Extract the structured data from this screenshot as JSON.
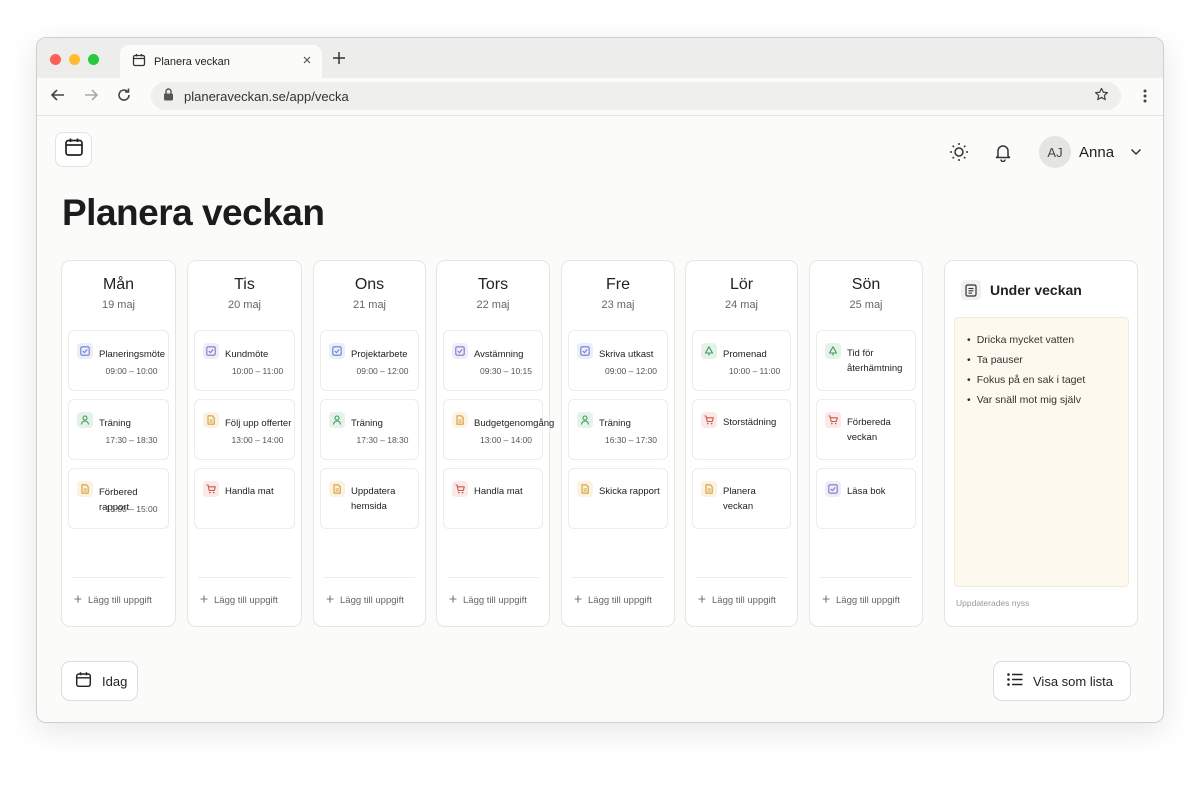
{
  "browser": {
    "tab_title": "Planera veckan",
    "url": "planeraveckan.se/app/vecka"
  },
  "header": {
    "user_initials": "AJ",
    "user_name": "Anna"
  },
  "page_title": "Planera veckan",
  "days": [
    {
      "name": "Mån",
      "date": "19 maj",
      "tasks": [
        {
          "label": "Planeringsmöte",
          "time": "09:00 – 10:00",
          "icon": "check-icon",
          "color": "#6b7fd0"
        },
        {
          "label": "Träning",
          "time": "17:30 – 18:30",
          "icon": "person-icon",
          "color": "#3f9a5a"
        },
        {
          "label": "Förbered rapport",
          "time": "13:00 – 15:00",
          "icon": "document-icon",
          "color": "#d9a030"
        }
      ]
    },
    {
      "name": "Tis",
      "date": "20 maj",
      "tasks": [
        {
          "label": "Kundmöte",
          "time": "10:00 – 11:00",
          "icon": "check-icon",
          "color": "#8a73c9"
        },
        {
          "label": "Följ upp offerter",
          "time": "13:00 – 14:00",
          "icon": "document-icon",
          "color": "#d9a030"
        },
        {
          "label": "Handla mat",
          "time": "",
          "icon": "cart-icon",
          "color": "#d0584b"
        }
      ]
    },
    {
      "name": "Ons",
      "date": "21 maj",
      "tasks": [
        {
          "label": "Projektarbete",
          "time": "09:00 – 12:00",
          "icon": "check-icon",
          "color": "#6b7fd0"
        },
        {
          "label": "Träning",
          "time": "17:30 – 18:30",
          "icon": "person-icon",
          "color": "#3f9a5a"
        },
        {
          "label": "Uppdatera hemsida",
          "time": "",
          "icon": "document-icon",
          "color": "#d9a030"
        }
      ]
    },
    {
      "name": "Tors",
      "date": "22 maj",
      "tasks": [
        {
          "label": "Avstämning",
          "time": "09:30 – 10:15",
          "icon": "check-icon",
          "color": "#8a73c9"
        },
        {
          "label": "Budgetgenomgång",
          "time": "13:00 – 14:00",
          "icon": "document-icon",
          "color": "#d9a030"
        },
        {
          "label": "Handla mat",
          "time": "",
          "icon": "cart-icon",
          "color": "#d0584b"
        }
      ]
    },
    {
      "name": "Fre",
      "date": "23 maj",
      "tasks": [
        {
          "label": "Skriva utkast",
          "time": "09:00 – 12:00",
          "icon": "check-icon",
          "color": "#6b7fd0"
        },
        {
          "label": "Träning",
          "time": "16:30 – 17:30",
          "icon": "person-icon",
          "color": "#3f9a5a"
        },
        {
          "label": "Skicka rapport",
          "time": "",
          "icon": "document-icon",
          "color": "#d9a030"
        }
      ]
    },
    {
      "name": "Lör",
      "date": "24 maj",
      "tasks": [
        {
          "label": "Promenad",
          "time": "10:00 – 11:00",
          "icon": "tree-icon",
          "color": "#3f9a5a"
        },
        {
          "label": "Storstädning",
          "time": "",
          "icon": "cart-icon",
          "color": "#d0584b"
        },
        {
          "label": "Planera veckan",
          "time": "",
          "icon": "document-icon",
          "color": "#d9a030"
        }
      ]
    },
    {
      "name": "Sön",
      "date": "25 maj",
      "tasks": [
        {
          "label": "Tid för återhämtning",
          "time": "",
          "icon": "tree-icon",
          "color": "#3f9a5a"
        },
        {
          "label": "Förbereda veckan",
          "time": "",
          "icon": "cart-icon",
          "color": "#d0584b"
        },
        {
          "label": "Läsa bok",
          "time": "",
          "icon": "check-icon",
          "color": "#8a73c9"
        }
      ]
    }
  ],
  "add_task_label": "Lägg till uppgift",
  "notes": {
    "title": "Under veckan",
    "items": [
      "Dricka mycket vatten",
      "Ta pauser",
      "Fokus på en sak i taget",
      "Var snäll mot mig själv"
    ],
    "footer": "Uppdaterades nyss"
  },
  "footer": {
    "today_label": "Idag",
    "list_view_label": "Visa som lista"
  }
}
